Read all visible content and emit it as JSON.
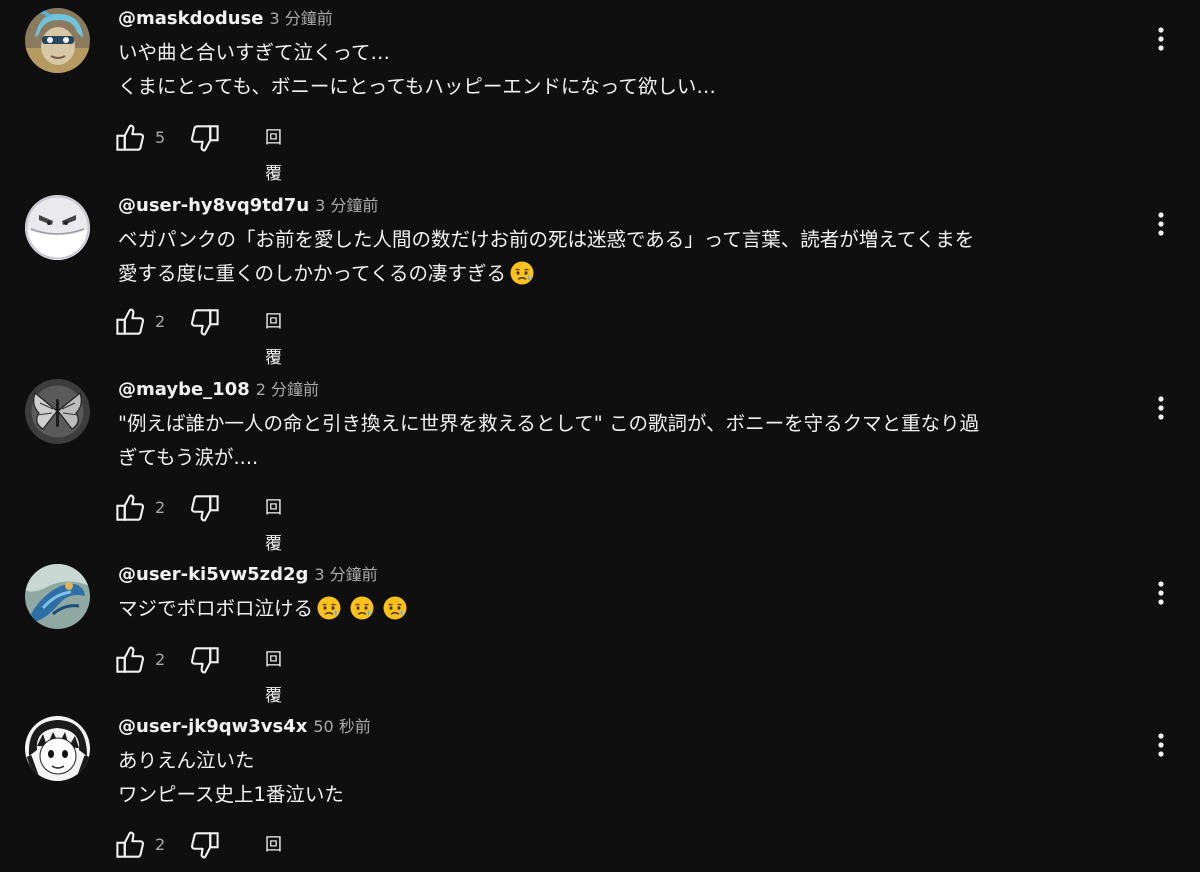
{
  "icons": {
    "like": "thumbs-up-icon",
    "dislike": "thumbs-down-icon",
    "menu": "more-vert-icon",
    "emoji": "crying-face-emoji"
  },
  "colors": {
    "background": "#0f0f0f",
    "text": "#f1f1f1",
    "secondary_text": "#aaaaaa"
  },
  "comments": [
    {
      "author": "@maskdoduse",
      "time": "3 分鐘前",
      "lines": [
        "いや曲と合いすぎて泣くって…",
        "くまにとっても、ボニーにとってもハッピーエンドになって欲しい…"
      ],
      "like_count": "5",
      "reply_label": "回覆",
      "emoji_count": 0
    },
    {
      "author": "@user-hy8vq9td7u",
      "time": "3 分鐘前",
      "lines": [
        "ベガパンクの「お前を愛した人間の数だけお前の死は迷惑である」って言葉、読者が増えてくまを",
        "愛する度に重くのしかかってくるの凄すぎる"
      ],
      "like_count": "2",
      "reply_label": "回覆",
      "emoji_count": 1
    },
    {
      "author": "@maybe_108",
      "time": "2 分鐘前",
      "lines": [
        "\"例えば誰か一人の命と引き換えに世界を救えるとして\" この歌詞が、ボニーを守るクマと重なり過",
        "ぎてもう涙が...."
      ],
      "like_count": "2",
      "reply_label": "回覆",
      "emoji_count": 0
    },
    {
      "author": "@user-ki5vw5zd2g",
      "time": "3 分鐘前",
      "lines": [
        "マジでボロボロ泣ける"
      ],
      "like_count": "2",
      "reply_label": "回覆",
      "emoji_count": 3
    },
    {
      "author": "@user-jk9qw3vs4x",
      "time": "50 秒前",
      "lines": [
        "ありえん泣いた",
        "ワンピース史上1番泣いた"
      ],
      "like_count": "2",
      "reply_label": "回覆",
      "emoji_count": 0
    }
  ]
}
